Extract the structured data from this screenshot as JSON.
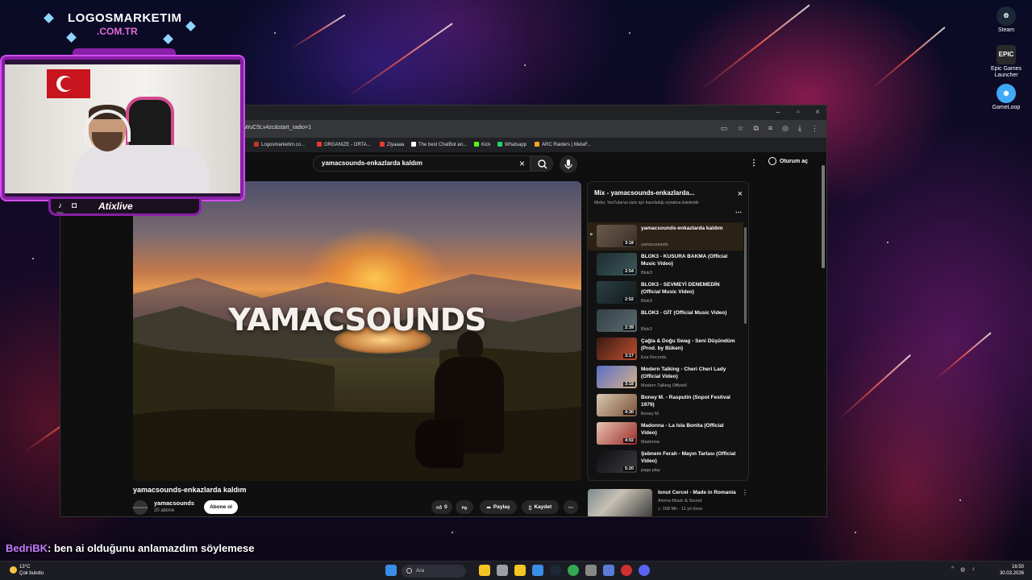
{
  "overlay": {
    "brand_line1": "LOGOSMARKETIM",
    "brand_line2": ".COM.TR",
    "streamer_name": "Atixlive",
    "social_label": "TikTok"
  },
  "chat": {
    "user": "BedriBK",
    "message": ": ben ai olduğunu anlamazdım söylemese"
  },
  "desktop_icons": [
    {
      "label": "Steam",
      "icon": "steam-icon",
      "color": "#1b2838"
    },
    {
      "label": "Epic Games Launcher",
      "icon": "epic-games-icon",
      "color": "#2a2a2a"
    },
    {
      "label": "GameLoop",
      "icon": "gameloop-icon",
      "color": "#3fa9f5"
    }
  ],
  "browser": {
    "url": "mWuC5Lv4zc&start_radio=1",
    "bookmarks": [
      {
        "label": "Logosmarketim.co...",
        "color": "#c0392b"
      },
      {
        "label": "ORGANIZE - ORTA...",
        "color": "#e53935"
      },
      {
        "label": "Ziyaaaa",
        "color": "#e53935"
      },
      {
        "label": "The best ChatBot an...",
        "color": "#ffffff"
      },
      {
        "label": "Kick",
        "color": "#53fc18"
      },
      {
        "label": "Whatsapp",
        "color": "#25d366"
      },
      {
        "label": "ARC Raiders | MetaF...",
        "color": "#f9a825"
      }
    ]
  },
  "youtube": {
    "search_value": "yamacsounds-enkazlarda kaldım",
    "signin_label": "Oturum aç",
    "thumbnail_text": "YAMACSOUNDS",
    "video_title": "yamacsounds-enkazlarda kaldım",
    "channel_name": "yamacsounds",
    "channel_subs": "20 abone",
    "channel_avatar_text": "yamacsounds",
    "subscribe_label": "Abone ol",
    "like_count": "0",
    "share_label": "Paylaş",
    "save_label": "Kaydet",
    "mix": {
      "title": "Mix - yamacsounds-enkazlarda...",
      "subtitle": "Mixler, YouTube'un sizin için hazırladığı oynatma listeleridir",
      "items": [
        {
          "title": "yamacsounds-enkazlarda kaldım",
          "artist": "yamacsounds",
          "duration": "3:18",
          "colors": [
            "#6b5a4a",
            "#3a3028"
          ],
          "active": true
        },
        {
          "title": "BLOK3 - KUSURA BAKMA (Official Music Video)",
          "artist": "Blok3",
          "duration": "2:54",
          "colors": [
            "#1d2b2e",
            "#3e5a5c"
          ],
          "active": false
        },
        {
          "title": "BLOK3 - SEVMEYİ DENEMEDİN (Official Music Video)",
          "artist": "Blok3",
          "duration": "2:52",
          "colors": [
            "#2c3f44",
            "#11191b"
          ],
          "active": false
        },
        {
          "title": "BLOK3 - GİT (Official Music Video)",
          "artist": "Blok3",
          "duration": "2:39",
          "colors": [
            "#344047",
            "#5a6b70"
          ],
          "active": false
        },
        {
          "title": "Çağla & Doğu Swag - Seni Düşündüm (Prod. by Büken)",
          "artist": "Eva Records",
          "duration": "3:17",
          "colors": [
            "#3a1a12",
            "#c05030"
          ],
          "active": false
        },
        {
          "title": "Modern Talking - Cheri Cheri Lady (Official Video)",
          "artist": "Modern Talking Offiziell",
          "duration": "3:18",
          "colors": [
            "#5a6fc8",
            "#d6b08a"
          ],
          "active": false
        },
        {
          "title": "Boney M. - Rasputin (Sopot Festival 1979)",
          "artist": "Boney M.",
          "duration": "4:30",
          "colors": [
            "#d8c9b0",
            "#7a4e38"
          ],
          "active": false
        },
        {
          "title": "Madonna - La Isla Bonita (Official Video)",
          "artist": "Madonna",
          "duration": "4:02",
          "colors": [
            "#e6c5b0",
            "#9a2a2a"
          ],
          "active": false
        },
        {
          "title": "Şebnem Ferah - Mayın Tarlası (Official Video)",
          "artist": "paga play",
          "duration": "5:20",
          "colors": [
            "#0f0f12",
            "#3a3a40"
          ],
          "active": false
        }
      ]
    },
    "recommendation": {
      "title": "Ionut Cercel - Made in Romania",
      "channel": "Amma Music & Sound",
      "meta": "▷ 168 Mn · 11 yıl önce"
    }
  },
  "taskbar": {
    "temperature": "13°C",
    "weather": "Çok bulutlu",
    "search_placeholder": "Ara",
    "time": "16:50",
    "date": "30.03.2026",
    "apps": [
      {
        "name": "start-icon",
        "color": "#3a8ee6"
      },
      {
        "name": "file-explorer-icon",
        "color": "#f3c623"
      },
      {
        "name": "task-view-icon",
        "color": "#9aa0a6"
      },
      {
        "name": "files-icon",
        "color": "#f3c623"
      },
      {
        "name": "store-icon",
        "color": "#3a8ee6"
      },
      {
        "name": "steam-icon",
        "color": "#1b2838"
      },
      {
        "name": "chrome-icon",
        "color": "#34a853"
      },
      {
        "name": "settings-icon",
        "color": "#888888"
      },
      {
        "name": "app-icon",
        "color": "#5b7bd6"
      },
      {
        "name": "xbox-icon",
        "color": "#d03030"
      },
      {
        "name": "discord-icon",
        "color": "#5865f2"
      }
    ]
  }
}
